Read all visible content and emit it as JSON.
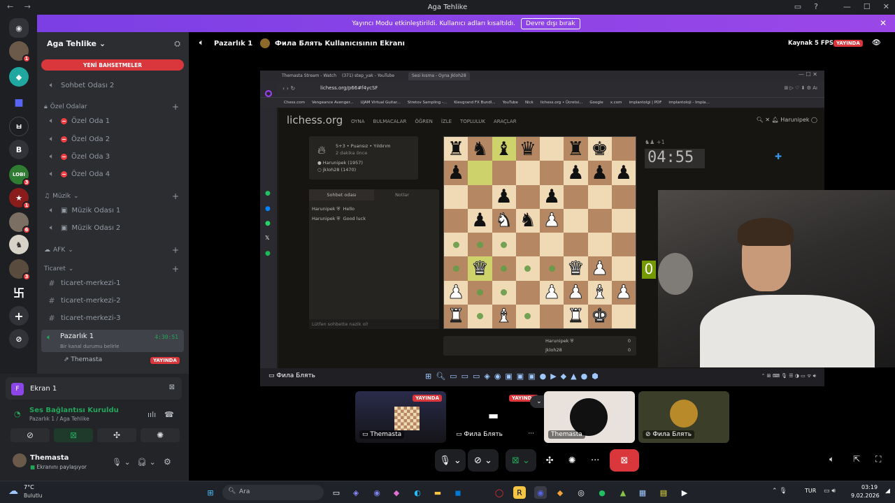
{
  "window": {
    "title": "Aga Tehlike"
  },
  "banner": {
    "text": "Yayıncı Modu etkinleştirildi. Kullanıcı adları kısaltıldı.",
    "button": "Devre dışı bırak"
  },
  "guild": {
    "name": "Aga Tehlike"
  },
  "sidebar": {
    "new_mentions": "YENİ BAHSETMELER",
    "chat_room": "Sohbet Odası 2",
    "private_category": "Özel Odalar",
    "private_rooms": [
      "Özel Oda 1",
      "Özel Oda 2",
      "Özel Oda 3",
      "Özel Oda 4"
    ],
    "music_category": "Müzik",
    "music_rooms": [
      "Müzik Odası 1",
      "Müzik Odası 2"
    ],
    "afk_category": "AFK",
    "trade_category": "Ticaret",
    "trade_channels": [
      "ticaret-merkezi-1",
      "ticaret-merkezi-2",
      "ticaret-merkezi-3"
    ],
    "active_channel": {
      "name": "Pazarlık 1",
      "timer": "4:30:51",
      "status": "Bir kanal durumu belirle",
      "member": "Themasta",
      "live": "YAYINDA"
    }
  },
  "voice_panel": {
    "screen_label": "Ekran 1",
    "connection": "Ses Bağlantısı Kuruldu",
    "location": "Pazarlık 1 / Aga Tehlike",
    "user": "Themasta",
    "user_status": "Ekranını paylaşıyor"
  },
  "stream_header": {
    "channel": "Pazarlık 1",
    "stream_title": "Фила Блять Kullanıcısının Ekranı",
    "source": "Kaynak 5 FPS",
    "live": "YAYINDA"
  },
  "browser": {
    "tabs": [
      "Themasta Stream - Watch",
      "(371) step_yak - YouTube",
      "Sesi kısma - Oyna Jkloh28"
    ],
    "url": "lichess.org/p66#f4ycSF",
    "bookmarks": [
      "Chess.com",
      "Vengeance Avenger...",
      "UJAM Virtual Guitar...",
      "Stretov Sampling -...",
      "Kievgrand FX Bundl...",
      "YouTube",
      "Nick",
      "lichess.org • Ücretsi...",
      "Google",
      "x.com",
      "implantolgi | PDF",
      "implantoloji - Impla..."
    ]
  },
  "lichess": {
    "logo": "lichess.org",
    "nav": [
      "OYNA",
      "BULMACALAR",
      "ÖĞREN",
      "İZLE",
      "TOPLULUK",
      "ARAÇLAR"
    ],
    "user": "Harunipek",
    "game_type": "5+3 • Puansız • Yıldırım",
    "game_time": "2 dakika önce",
    "player_white": "Harunipek (1957)",
    "player_black": "jkloh28 (1470)",
    "chat_tab": "Sohbet odası",
    "notes_tab": "Notlar",
    "chat": [
      {
        "user": "Harunipek",
        "msg": "Hello"
      },
      {
        "user": "Harunipek",
        "msg": "Good luck"
      }
    ],
    "chat_placeholder": "Lütfen sohbette nazik ol!",
    "clock": "04:55",
    "clock_plus": "+1",
    "clock_bottom": "0",
    "score_rows": [
      {
        "name": "Harunipek",
        "score": "0"
      },
      {
        "name": "jkloh28",
        "score": "0"
      }
    ]
  },
  "board": [
    [
      "bR",
      "bN",
      "bB:hl",
      "bQ",
      "",
      "bR",
      "bK",
      ""
    ],
    [
      "bP",
      "hlg",
      "",
      "",
      "",
      "bP",
      "bP",
      "bP"
    ],
    [
      "",
      "",
      "bP",
      "",
      "bP",
      "",
      "",
      ""
    ],
    [
      "",
      "bP",
      "wN",
      "bN",
      "wP",
      "",
      "",
      ""
    ],
    [
      ".",
      ".",
      ".",
      "",
      "",
      "",
      "",
      ""
    ],
    [
      ".",
      "wQ:hl",
      ".",
      ".",
      ".",
      "wQ",
      "wP",
      ""
    ],
    [
      "wP",
      ".",
      ".",
      "",
      "wP",
      "wP",
      "wB",
      "wP"
    ],
    [
      "wR",
      ".",
      "wB",
      ".",
      "",
      "wR",
      "wK",
      ""
    ]
  ],
  "browser_taskbar": {
    "label": "Фила Блять"
  },
  "thumbnails": [
    {
      "name": "Themasta",
      "live": "YAYINDA"
    },
    {
      "name": "Фила Блять",
      "live": "YAYINDA"
    },
    {
      "name": "Themasta"
    },
    {
      "name": "Фила Блять"
    }
  ],
  "taskbar": {
    "weather_temp": "7°C",
    "weather_text": "Bulutlu",
    "search": "Ara",
    "lang": "TUR",
    "time": "03:19",
    "date": "9.02.2026"
  },
  "colors": {
    "live": "#da373c",
    "discord_bg": "#2b2d31",
    "banner": "#8c45e6",
    "green": "#23a559"
  }
}
